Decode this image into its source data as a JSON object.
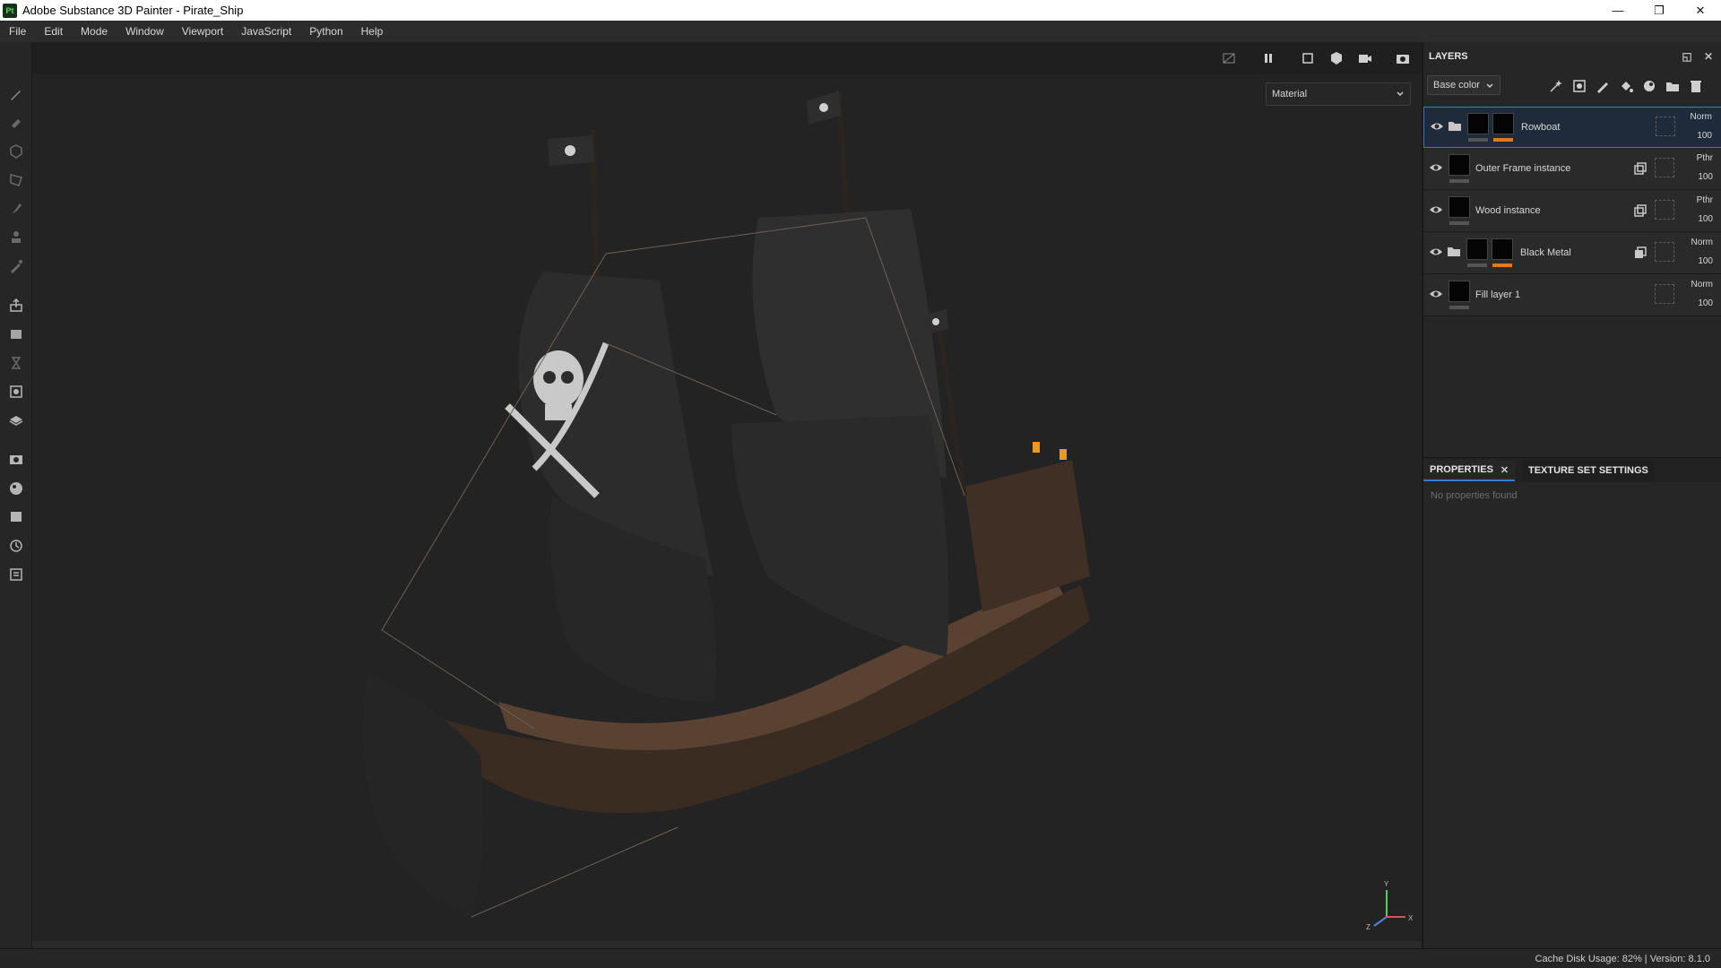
{
  "window": {
    "title": "Adobe Substance 3D Painter - Pirate_Ship",
    "app_badge": "Pt",
    "controls": [
      "—",
      "❐",
      "✕"
    ]
  },
  "menu": [
    "File",
    "Edit",
    "Mode",
    "Window",
    "Viewport",
    "JavaScript",
    "Python",
    "Help"
  ],
  "viewport": {
    "material_mode": "Material",
    "axis_labels": {
      "x": "X",
      "y": "Y",
      "z": "Z"
    }
  },
  "layers_panel": {
    "title": "LAYERS",
    "channel": "Base color",
    "layers": [
      {
        "name": "Rowboat",
        "blend": "Norm",
        "opacity": "100",
        "selected": true
      },
      {
        "name": "Outer Frame instance",
        "blend": "Pthr",
        "opacity": "100",
        "selected": false
      },
      {
        "name": "Wood instance",
        "blend": "Pthr",
        "opacity": "100",
        "selected": false
      },
      {
        "name": "Black Metal",
        "blend": "Norm",
        "opacity": "100",
        "selected": false
      },
      {
        "name": "Fill layer 1",
        "blend": "Norm",
        "opacity": "100",
        "selected": false
      }
    ]
  },
  "properties_panel": {
    "tabs": [
      "PROPERTIES",
      "TEXTURE SET SETTINGS"
    ],
    "empty_text": "No properties found"
  },
  "status": {
    "text": "Cache Disk Usage:   82% | Version: 8.1.0"
  },
  "colors": {
    "accent": "#3d79c9",
    "mask_orange": "#e07a1f"
  }
}
